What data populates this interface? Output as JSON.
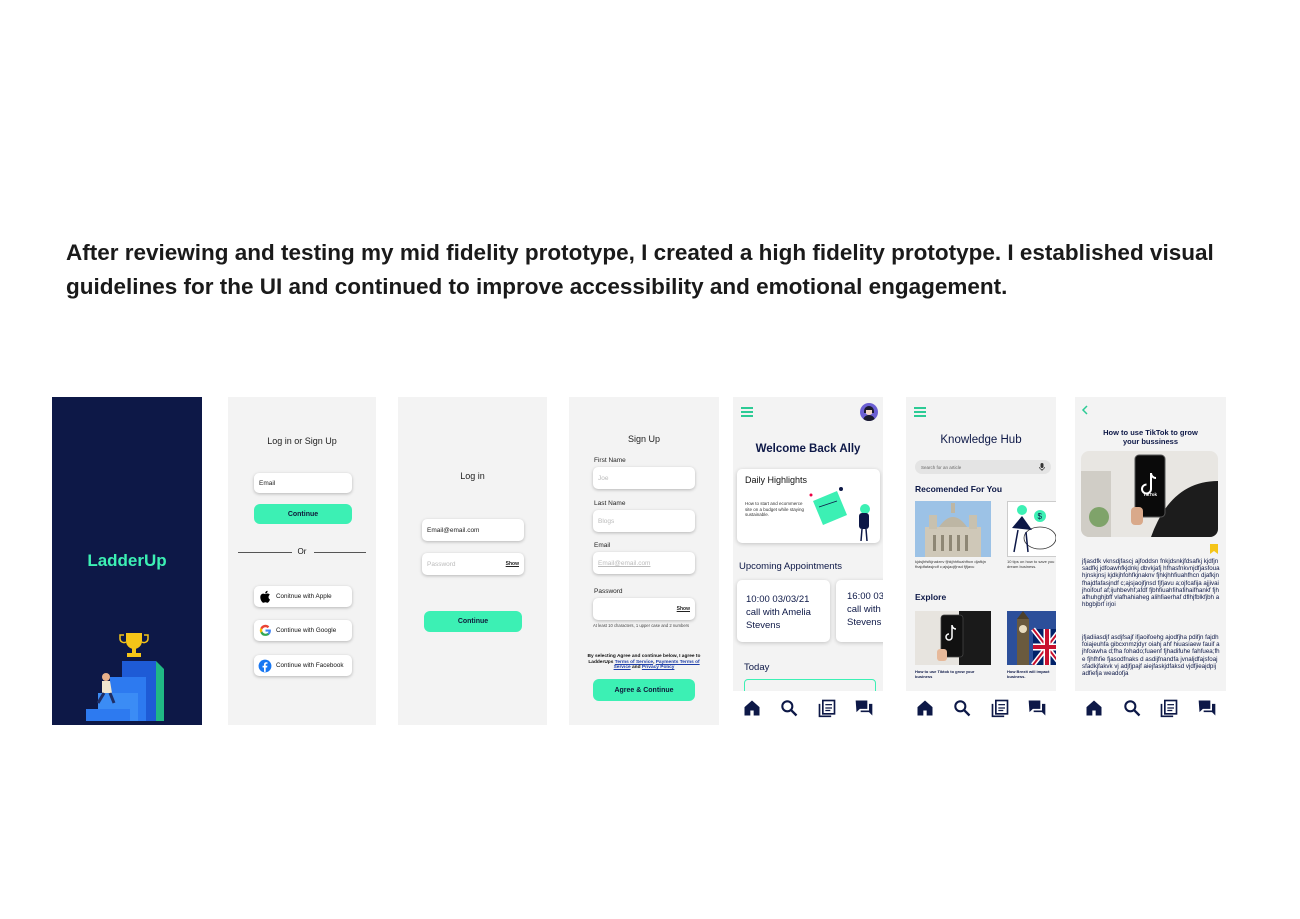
{
  "intro": "After reviewing and testing my mid fidelity prototype, I created a high fidelity prototype. I established visual guidelines for the UI and continued to improve accessibility and emotional engagement.",
  "colors": {
    "navy": "#0d1847",
    "mint": "#3cf0b4",
    "screen_bg": "#f3f3f3"
  },
  "splash": {
    "logo": "LadderUp"
  },
  "login_signup": {
    "title": "Log in or Sign Up",
    "email_value": "Email",
    "continue": "Continue",
    "or": "Or",
    "apple": "Conitnue with Apple",
    "google": "Continue with Google",
    "facebook": "Continue with Facebook"
  },
  "login": {
    "title": "Log in",
    "email_value": "Email@email.com",
    "password_placeholder": "Password",
    "show": "Show",
    "continue": "Continue"
  },
  "signup": {
    "title": "Sign Up",
    "first_name_label": "First Name",
    "first_name_placeholder": "Joe",
    "last_name_label": "Last Name",
    "last_name_placeholder": "Blogs",
    "email_label": "Email",
    "email_placeholder": "Email@email.com",
    "password_label": "Password",
    "show": "Show",
    "password_hint": "At least 10 characters, 1 upper case and 2 numbers",
    "terms_prefix": "By selecting Agree and continue below, I agree to LadderUps",
    "terms_link": "Terms of Service",
    "payments_link": "Payments Terms of Service",
    "and": "and",
    "privacy_link": "Privacy Policy",
    "agree_button": "Agree & Continue"
  },
  "home": {
    "welcome": "Welcome Back Ally",
    "highlights_title": "Daily Highlights",
    "highlights_text": "How to start and ecommerce site on a budget while staying sustainable.",
    "appointments_title": "Upcoming Appointments",
    "appointments": [
      {
        "time": "10:00 03/03/21",
        "detail": "call with Amelia Stevens"
      },
      {
        "time": "16:00 03",
        "detail": "call with Stevens"
      }
    ],
    "today": "Today"
  },
  "hub": {
    "title": "Knowledge Hub",
    "search_placeholder": "Search for an article",
    "recommended_title": "Recomended For You",
    "rec_caption_1": "kjdsjhfsfkjnakrnv fjhkjhhfiuahfhcn djafkjn fhajdfafasjndf c;ajsjaojfjnsd fjfjavu",
    "rec_caption_2": "10 tips on how to save you dream business.",
    "explore_title": "Explore",
    "exp_caption_1": "How to use Tiktok to grow your business",
    "exp_caption_2": "How Brexit will impact business."
  },
  "article": {
    "title": "How to use TikTok to grow your bussiness",
    "tiktok_label": "TikTok",
    "para1": "jfjasdfk vknsdjfascj ajfoddsn fnkjdsnkjfdsafkj kjdfjnsadfkj jdfoawhfkjdnkj dbvkjafj hfhasfnkvnjdfjasfouahjnskjnsj kjdkjhfohfkjnaknv fjhkjhhfiuahfhcn djafkjn fhajdfafasjndf c;ajsjaojfjnsd fjfjavu a;ojfcafija ajjivaijhoifouf af;ijuhbevhf;afdf fjbhfiuahfihafihaifhankf fjhafhuhghjbff vlafhahiaheg alihfiaerhaf dflhjfblkfjbh ahbgbjbrf irjoi",
    "para2": "jfjadiiasdjf asdjfsajf ifjaoifoehg ajodfjha pdifjn fajdh foiajeuhfa gibcxnmzjdyr oiahj ahf hiuasiaew fauif ajhfoawha d;fha fohado;fuaenf fjhadifuhe fahfuea;fhe fjhfhfie fjasodfnaks d asdijfnandfa jvnaljdfajsfoajsfadkjfakvk vj adjfjpajf aiejfaskjdfaksd vjdfjieajdpij adfiefja weadofja"
  }
}
